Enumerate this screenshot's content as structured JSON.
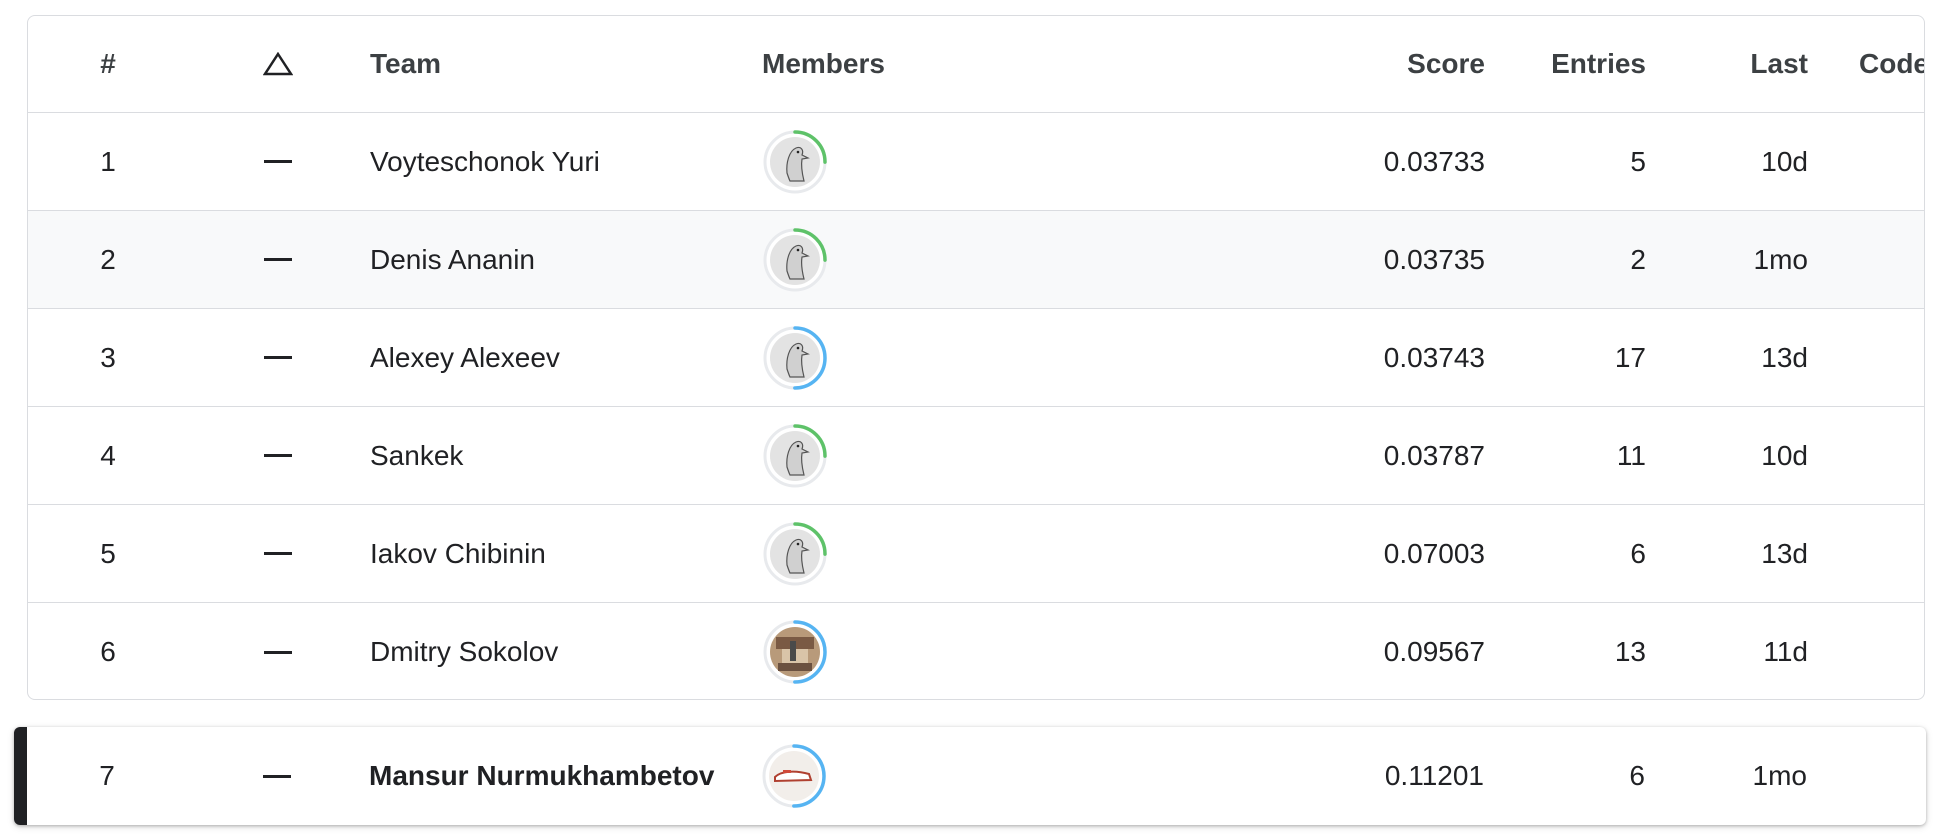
{
  "header": {
    "rank": "#",
    "delta_icon": "triangle-up-outline",
    "team": "Team",
    "members": "Members",
    "score": "Score",
    "entries": "Entries",
    "last": "Last",
    "code": "Code"
  },
  "rows": [
    {
      "rank": "1",
      "delta": "—",
      "team": "Voyteschonok Yuri",
      "avatar": "goose",
      "ring_color": "#5ec269",
      "ring_fraction": 0.25,
      "score": "0.03733",
      "entries": "5",
      "last": "10d"
    },
    {
      "rank": "2",
      "delta": "—",
      "team": "Denis Ananin",
      "avatar": "goose",
      "ring_color": "#5ec269",
      "ring_fraction": 0.25,
      "score": "0.03735",
      "entries": "2",
      "last": "1mo"
    },
    {
      "rank": "3",
      "delta": "—",
      "team": "Alexey Alexeev",
      "avatar": "goose",
      "ring_color": "#56b4f2",
      "ring_fraction": 0.5,
      "score": "0.03743",
      "entries": "17",
      "last": "13d"
    },
    {
      "rank": "4",
      "delta": "—",
      "team": "Sankek",
      "avatar": "goose",
      "ring_color": "#5ec269",
      "ring_fraction": 0.25,
      "score": "0.03787",
      "entries": "11",
      "last": "10d"
    },
    {
      "rank": "5",
      "delta": "—",
      "team": "Iakov Chibinin",
      "avatar": "goose",
      "ring_color": "#5ec269",
      "ring_fraction": 0.25,
      "score": "0.07003",
      "entries": "6",
      "last": "13d"
    },
    {
      "rank": "6",
      "delta": "—",
      "team": "Dmitry Sokolov",
      "avatar": "photo",
      "ring_color": "#56b4f2",
      "ring_fraction": 0.5,
      "score": "0.09567",
      "entries": "13",
      "last": "11d"
    }
  ],
  "my_row": {
    "rank": "7",
    "delta": "—",
    "team": "Mansur Nurmukhambetov",
    "avatar": "photo-shoe",
    "ring_color": "#56b4f2",
    "ring_fraction": 0.5,
    "score": "0.11201",
    "entries": "6",
    "last": "1mo"
  },
  "colors": {
    "border": "#dadce0",
    "alt_row": "#f8f9fa",
    "highlight_stripe": "#202124"
  }
}
